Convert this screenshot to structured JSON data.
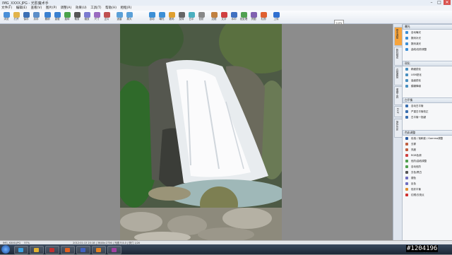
{
  "window": {
    "title": "IMG_XXXX.JPG - 光影魔术手",
    "minimize": "–",
    "maximize": "□",
    "close": "✕"
  },
  "menu": [
    "文件(F)",
    "编辑(E)",
    "查看(V)",
    "图片(P)",
    "调整(A)",
    "效果(U)",
    "工具(T)",
    "帮助(H)",
    "相框(R)"
  ],
  "toolbar": {
    "buttons": [
      {
        "label": "浏览"
      },
      {
        "label": "打开"
      },
      {
        "label": "保存"
      },
      {
        "label": "另存"
      },
      {
        "label": "撤销"
      },
      {
        "label": "重做"
      },
      {
        "label": "旋转"
      },
      {
        "label": "裁剪"
      },
      {
        "label": "缩放"
      },
      {
        "label": "尺寸"
      },
      {
        "label": "正片"
      },
      {
        "label": "适窗"
      },
      {
        "label": "原大"
      },
      {
        "label": "自动"
      },
      {
        "label": "曝光"
      },
      {
        "label": "数码"
      },
      {
        "label": "反转"
      },
      {
        "label": "白平"
      },
      {
        "label": "色阶"
      },
      {
        "label": "边框"
      },
      {
        "label": "文字"
      },
      {
        "label": "水印"
      },
      {
        "label": "批处理"
      },
      {
        "label": "拼图"
      },
      {
        "label": "礼物"
      },
      {
        "label": "上传"
      }
    ],
    "zoom_value": "0.0%"
  },
  "right_panel": {
    "tabs": [
      "基本调整",
      "数码暗房",
      "边框图层",
      "便捷工具",
      "EXIF",
      "操作历史"
    ],
    "sections": [
      {
        "title": "曝光",
        "items": [
          "自动曝光",
          "数码补光",
          "数码减光",
          "曲线/色阶调整"
        ]
      },
      {
        "title": "锐化",
        "items": [
          "精细锐化",
          "USM锐化",
          "高级锐化",
          "模糊降噪"
        ]
      },
      {
        "title": "白平衡",
        "items": [
          "自动白平衡",
          "严重白平衡校正",
          "白平衡一指键"
        ]
      },
      {
        "title": "色彩调整",
        "items": [
          "色相 / 饱和度 / Gamma调整",
          "去雾",
          "亮度",
          "RGB色调",
          "色阶/曲线调整",
          "自动色阶",
          "去色/黑白",
          "褪色",
          "反色",
          "色彩平衡",
          "红眼/去斑点"
        ]
      }
    ]
  },
  "status": {
    "left": "IMG_XXXX.JPG",
    "zoom": "57%",
    "info": "2012:01:13 20:18 | 3648×2736 | 光圈 F/4.0 | 快门 1/20"
  },
  "taskbar": {
    "clock": "20:18",
    "date": "2012/1/13"
  },
  "watermark": "#1204196",
  "colors": {
    "accent": "#f7a43c",
    "titlebar": "#e8eef6",
    "taskbar": "#1c2736",
    "workspace": "#8c8c8c"
  }
}
